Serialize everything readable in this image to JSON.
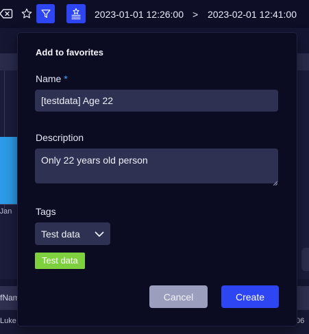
{
  "toolbar": {
    "icons": [
      "clear-filter-icon",
      "star-icon",
      "filter-icon",
      "saved-searches-icon"
    ],
    "range_from": "2023-01-01 12:26:00",
    "range_separator": ">",
    "range_to": "2023-02-01 12:41:00"
  },
  "background": {
    "x_label": "-Jan",
    "column_header": "fNam",
    "row_cell": "Luke",
    "row_cell_right": "06"
  },
  "modal": {
    "title": "Add to favorites",
    "name_label": "Name",
    "name_required": "*",
    "name_value": "[testdata] Age 22",
    "description_label": "Description",
    "description_value": "Only 22 years old person",
    "tags_label": "Tags",
    "tags_selected": "Test data",
    "tag_chips": [
      "Test data"
    ],
    "cancel_label": "Cancel",
    "create_label": "Create"
  },
  "colors": {
    "accent": "#2d45f3",
    "chip": "#7ed03e",
    "modal_bg": "#0b0c22",
    "field_bg": "#2f3153"
  }
}
